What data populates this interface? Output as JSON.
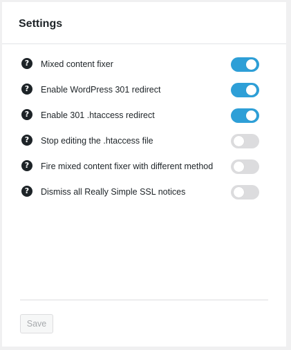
{
  "settings_card": {
    "title": "Settings",
    "help_icon_glyph": "?",
    "items": [
      {
        "label": "Mixed content fixer",
        "enabled": true,
        "icon": "question-circle-icon"
      },
      {
        "label": "Enable WordPress 301 redirect",
        "enabled": true,
        "icon": "question-circle-icon"
      },
      {
        "label": "Enable 301 .htaccess redirect",
        "enabled": true,
        "icon": "question-circle-icon"
      },
      {
        "label": "Stop editing the .htaccess file",
        "enabled": false,
        "icon": "question-circle-icon"
      },
      {
        "label": "Fire mixed content fixer with different method",
        "enabled": false,
        "icon": "question-circle-icon"
      },
      {
        "label": "Dismiss all Really Simple SSL notices",
        "enabled": false,
        "icon": "question-circle-icon"
      }
    ],
    "save_label": "Save",
    "save_disabled": true
  },
  "colors": {
    "page_background": "#f0f0f1",
    "card_background": "#ffffff",
    "toggle_on": "#2e9fd7",
    "toggle_off": "#dcdcde",
    "text": "#1d2327"
  }
}
